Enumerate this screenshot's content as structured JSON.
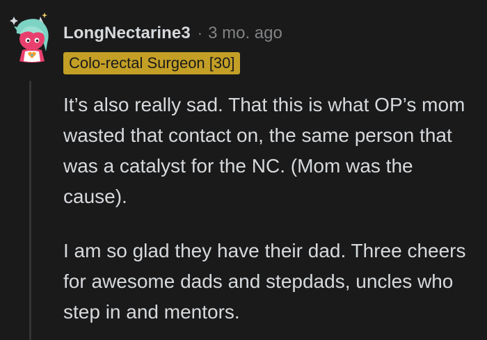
{
  "comment": {
    "author": "LongNectarine3",
    "separator": "·",
    "timestamp": "3 mo. ago",
    "flair": "Colo-rectal Surgeon [30]",
    "paragraphs": [
      "It’s also really sad. That this is what OP’s mom wasted that contact on, the same person that was a catalyst for the NC. (Mom was the cause).",
      "I am so glad they have their dad. Three cheers for awesome dads and stepdads, uncles who step in and mentors."
    ]
  },
  "colors": {
    "background": "#1a1a1b",
    "text": "#d7dadc",
    "muted": "#818384",
    "flair_bg": "#c39f26",
    "thread_line": "#343536"
  }
}
